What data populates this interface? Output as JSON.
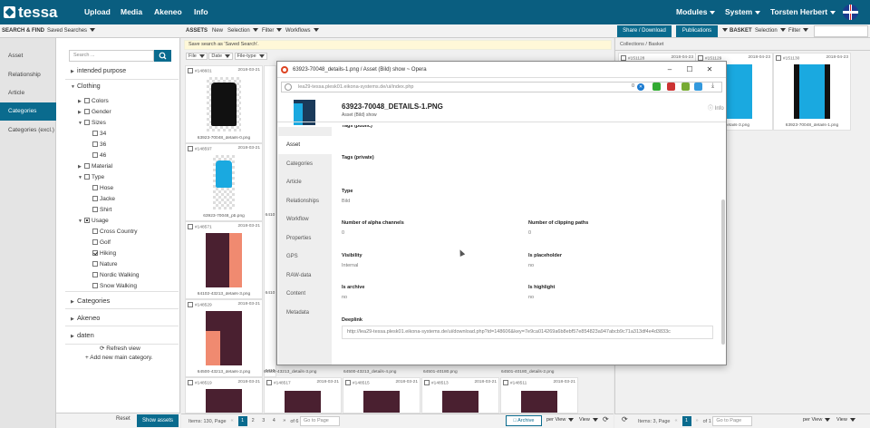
{
  "app": {
    "logo": "tessa",
    "nav": [
      "Upload",
      "Media",
      "Akeneo",
      "Info"
    ],
    "right_nav": [
      "Modules",
      "System",
      "Torsten Herbert"
    ]
  },
  "left_toolbar": {
    "title": "SEARCH & FIND",
    "saved": "Saved Searches"
  },
  "left_tabs": [
    "Asset",
    "Relationship",
    "Article",
    "Categories",
    "Categories (excl.)"
  ],
  "tree": {
    "search_placeholder": "Search ...",
    "nodes": [
      {
        "label": "intended purpose",
        "type": "collapsed-section"
      },
      {
        "label": "Clothing",
        "type": "expanded-section"
      },
      {
        "label": "Colors",
        "level": 1
      },
      {
        "label": "Gender",
        "level": 1
      },
      {
        "label": "Sizes",
        "level": 1
      },
      {
        "label": "34",
        "level": 2
      },
      {
        "label": "36",
        "level": 2
      },
      {
        "label": "46",
        "level": 2
      },
      {
        "label": "Material",
        "level": 1
      },
      {
        "label": "Type",
        "level": 1
      },
      {
        "label": "Hose",
        "level": 2
      },
      {
        "label": "Jacke",
        "level": 2
      },
      {
        "label": "Shirt",
        "level": 2
      },
      {
        "label": "Usage",
        "level": 1
      },
      {
        "label": "Cross Country",
        "level": 2
      },
      {
        "label": "Golf",
        "level": 2
      },
      {
        "label": "Hiking",
        "level": 2,
        "checked": true
      },
      {
        "label": "Nature",
        "level": 2
      },
      {
        "label": "Nordic Walking",
        "level": 2
      },
      {
        "label": "Snow Walking",
        "level": 2
      }
    ],
    "sections": [
      "Categories",
      "Akeneo",
      "daten"
    ],
    "refresh": "Refresh view",
    "add": "Add new main category.",
    "reset": "Reset",
    "show": "Show assets"
  },
  "assets_toolbar": {
    "title": "ASSETS",
    "items": [
      "New",
      "Selection",
      "Filter",
      "Workflows"
    ]
  },
  "notice": "Save search as 'Saved Search'.",
  "sort": [
    "File",
    "Date",
    "File-type"
  ],
  "grid": [
    {
      "id": "#148601",
      "date": "2018-03-21",
      "file": "63923-70048_details-0.png"
    },
    {
      "id": "#148597",
      "date": "2018-03-21",
      "file": "63923-70048_pb.png"
    },
    {
      "id": "#148571",
      "date": "2018-03-21",
      "file": "64102-43213_details-3.png"
    },
    {
      "id": "#148529",
      "date": "2018-03-21",
      "file": "64500-43213_details-2.png"
    },
    {
      "id": "#148519",
      "date": "2018-03-21",
      "file": ""
    }
  ],
  "grid_extra": {
    "lower_files": [
      "64500-43213_details-3.png",
      "64500-43213_details-4.png",
      "64501-40180.png",
      "64501-40180_details-2.png"
    ],
    "bottom_ids": [
      "#148517",
      "#148515",
      "#148513",
      "#148511"
    ],
    "bottom_dates": [
      "2018-03-21",
      "2018-03-21",
      "2018-03-21",
      "2018-03-21"
    ],
    "partial_files": [
      "6410",
      "6410",
      "6410"
    ]
  },
  "pager": {
    "items": "Items: 130, Page",
    "pages": [
      "1",
      "2",
      "3",
      "4"
    ],
    "of": "of 6",
    "goto": "Go to Page",
    "archive": "Archive",
    "per_view": "per View",
    "view": "View"
  },
  "basket_toolbar": {
    "share": "Share / Download",
    "pubs": "Publications",
    "basket": "BASKET",
    "items": [
      "Selection",
      "Filter"
    ]
  },
  "basket": {
    "crumbs": "Collections  /  Basket",
    "assets": [
      {
        "id": "#151128",
        "date": "2018-04-23",
        "file": ""
      },
      {
        "id": "#151129",
        "date": "2018-04-23",
        "file": "..._details-3.png"
      },
      {
        "id": "#151130",
        "date": "2018-04-23",
        "file": "63923-70048_details-1.png"
      }
    ],
    "pager": {
      "items": "Items: 3, Page",
      "pages": [
        "1"
      ],
      "of": "of 1",
      "goto": "Go to Page"
    }
  },
  "popup": {
    "window_title": "63923-70048_details-1.png / Asset (Bild) show ~ Opera",
    "url": "lea29-tessa.plesk01.eikona-systems.de/ui/index.php",
    "url_badge": "0",
    "asset_title": "63923-70048_DETAILS-1.PNG",
    "asset_sub": "Asset (Bild) show",
    "info": "Info",
    "nav": [
      "Asset",
      "Categories",
      "Article",
      "Relationships",
      "Workflow",
      "Properties",
      "GPS",
      "RAW-data",
      "Content",
      "Metadata"
    ],
    "fields": {
      "tags_public": "Tags (public)",
      "tags_private": "Tags (private)",
      "type_label": "Type",
      "type_val": "Bild",
      "alpha_label": "Number of alpha channels",
      "alpha_val": "0",
      "clip_label": "Number of clipping paths",
      "clip_val": "0",
      "vis_label": "Visibility",
      "vis_val": "Internal",
      "placeholder_label": "Is placeholder",
      "placeholder_val": "no",
      "archive_label": "Is archive",
      "archive_val": "no",
      "highlight_label": "Is highlight",
      "highlight_val": "no",
      "deeplink_label": "Deeplink",
      "deeplink_val": "http://lea29-tessa.plesk01.eikona-systems.de/ui/download.php?id=148606&key=7e9ca014269a6b8ebf57e854823a947abcb9c71a313df4e4d3833c"
    }
  },
  "colors": {
    "brand": "#0a5e80",
    "accent": "#0a6b8e",
    "maroon": "#4a2030",
    "coral": "#f08a70",
    "cyan": "#1aa9e0"
  }
}
